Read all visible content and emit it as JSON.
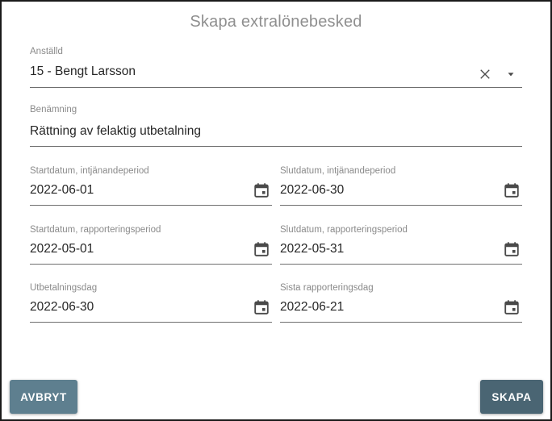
{
  "dialog": {
    "title": "Skapa extralönebesked"
  },
  "employee": {
    "label": "Anställd",
    "value": "15 - Bengt Larsson"
  },
  "description": {
    "label": "Benämning",
    "value": "Rättning av felaktig utbetalning"
  },
  "earning_start": {
    "label": "Startdatum, intjänandeperiod",
    "value": "2022-06-01"
  },
  "earning_end": {
    "label": "Slutdatum, intjänandeperiod",
    "value": "2022-06-30"
  },
  "report_start": {
    "label": "Startdatum, rapporteringsperiod",
    "value": "2022-05-01"
  },
  "report_end": {
    "label": "Slutdatum, rapporteringsperiod",
    "value": "2022-05-31"
  },
  "payment_day": {
    "label": "Utbetalningsdag",
    "value": "2022-06-30"
  },
  "last_report_day": {
    "label": "Sista rapporteringsdag",
    "value": "2022-06-21"
  },
  "actions": {
    "cancel_label": "AVBRYT",
    "create_label": "SKAPA"
  },
  "colors": {
    "primary_button": "#4a6573",
    "secondary_button": "#5e7f8f",
    "label_text": "#8a8a8a",
    "value_text": "#262626",
    "icon": "#4a4a4a"
  },
  "icons": {
    "clear": "close-icon",
    "dropdown": "caret-down-icon",
    "date": "calendar-icon"
  }
}
